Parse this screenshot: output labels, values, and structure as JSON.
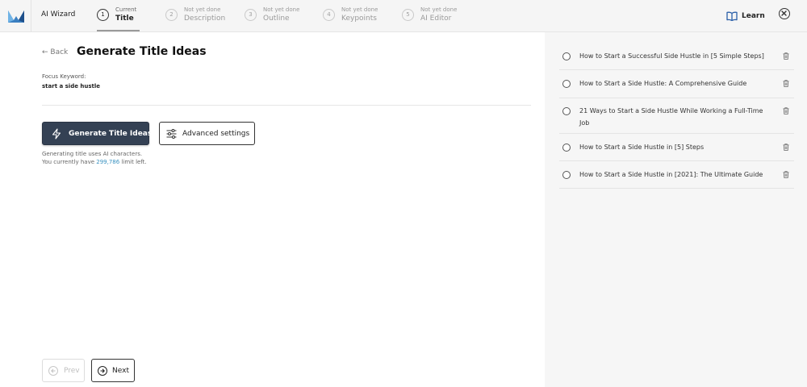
{
  "header": {
    "app_title": "AI Wizard",
    "learn_label": "Learn",
    "steps": [
      {
        "number": "1",
        "status": "Current",
        "name": "Title"
      },
      {
        "number": "2",
        "status": "Not yet done",
        "name": "Description"
      },
      {
        "number": "3",
        "status": "Not yet done",
        "name": "Outline"
      },
      {
        "number": "4",
        "status": "Not yet done",
        "name": "Keypoints"
      },
      {
        "number": "5",
        "status": "Not yet done",
        "name": "AI Editor"
      }
    ]
  },
  "main": {
    "back_label": "← Back",
    "title": "Generate Title Ideas",
    "focus_keyword_label": "Focus Keyword:",
    "focus_keyword_value": "start a side hustle",
    "generate_button_label": "Generate Title Ideas",
    "advanced_button_label": "Advanced settings",
    "note_line1": "Generating title uses AI characters.",
    "note_line2_prefix": "You currently have ",
    "note_limit": "299,786",
    "note_line2_suffix": " limit left.",
    "prev_label": "Prev",
    "next_label": "Next"
  },
  "ideas": [
    "How to Start a Successful Side Hustle in [5 Simple Steps]",
    "How to Start a Side Hustle: A Comprehensive Guide",
    "21 Ways to Start a Side Hustle While Working a Full-Time Job",
    "How to Start a Side Hustle in [5] Steps",
    "How to Start a Side Hustle in [2021]: The Ultimate Guide"
  ],
  "colors": {
    "primary_button": "#344154",
    "accent_link": "#3a92c0",
    "header_bg": "#f5f5f5",
    "panel_bg": "#f6f6f6"
  }
}
